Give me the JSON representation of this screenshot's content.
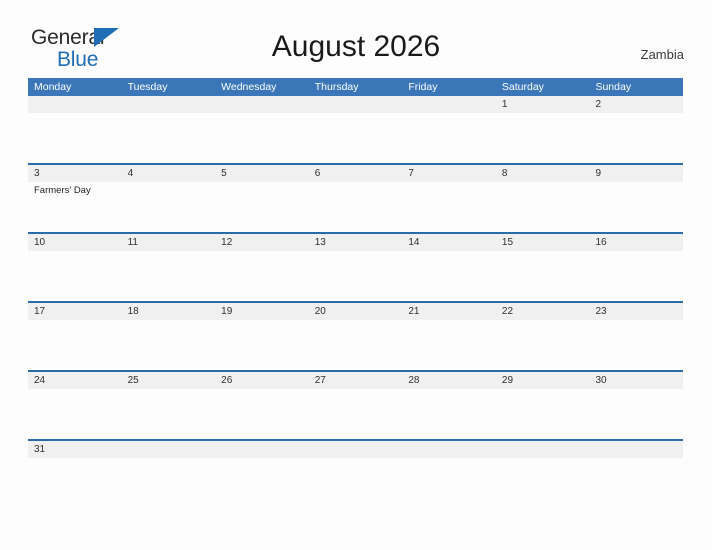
{
  "brand": {
    "name_part1": "General",
    "name_part2": "Blue",
    "color_primary": "#1f6eb5",
    "color_text": "#2b2b2b"
  },
  "header": {
    "title": "August 2026",
    "region": "Zambia"
  },
  "theme": {
    "header_blue": "#3a76b8",
    "divider_blue": "#2b6ca8",
    "daynum_band": "#f0f0f0",
    "page_background": "#fdfdfd"
  },
  "calendar": {
    "month": "August",
    "year": "2026",
    "weekday_headers": [
      "Monday",
      "Tuesday",
      "Wednesday",
      "Thursday",
      "Friday",
      "Saturday",
      "Sunday"
    ],
    "weeks": [
      {
        "days": [
          {
            "num": "",
            "events": []
          },
          {
            "num": "",
            "events": []
          },
          {
            "num": "",
            "events": []
          },
          {
            "num": "",
            "events": []
          },
          {
            "num": "",
            "events": []
          },
          {
            "num": "1",
            "events": []
          },
          {
            "num": "2",
            "events": []
          }
        ]
      },
      {
        "days": [
          {
            "num": "3",
            "events": [
              "Farmers' Day"
            ]
          },
          {
            "num": "4",
            "events": []
          },
          {
            "num": "5",
            "events": []
          },
          {
            "num": "6",
            "events": []
          },
          {
            "num": "7",
            "events": []
          },
          {
            "num": "8",
            "events": []
          },
          {
            "num": "9",
            "events": []
          }
        ]
      },
      {
        "days": [
          {
            "num": "10",
            "events": []
          },
          {
            "num": "11",
            "events": []
          },
          {
            "num": "12",
            "events": []
          },
          {
            "num": "13",
            "events": []
          },
          {
            "num": "14",
            "events": []
          },
          {
            "num": "15",
            "events": []
          },
          {
            "num": "16",
            "events": []
          }
        ]
      },
      {
        "days": [
          {
            "num": "17",
            "events": []
          },
          {
            "num": "18",
            "events": []
          },
          {
            "num": "19",
            "events": []
          },
          {
            "num": "20",
            "events": []
          },
          {
            "num": "21",
            "events": []
          },
          {
            "num": "22",
            "events": []
          },
          {
            "num": "23",
            "events": []
          }
        ]
      },
      {
        "days": [
          {
            "num": "24",
            "events": []
          },
          {
            "num": "25",
            "events": []
          },
          {
            "num": "26",
            "events": []
          },
          {
            "num": "27",
            "events": []
          },
          {
            "num": "28",
            "events": []
          },
          {
            "num": "29",
            "events": []
          },
          {
            "num": "30",
            "events": []
          }
        ]
      },
      {
        "days": [
          {
            "num": "31",
            "events": []
          },
          {
            "num": "",
            "events": []
          },
          {
            "num": "",
            "events": []
          },
          {
            "num": "",
            "events": []
          },
          {
            "num": "",
            "events": []
          },
          {
            "num": "",
            "events": []
          },
          {
            "num": "",
            "events": []
          }
        ]
      }
    ]
  }
}
